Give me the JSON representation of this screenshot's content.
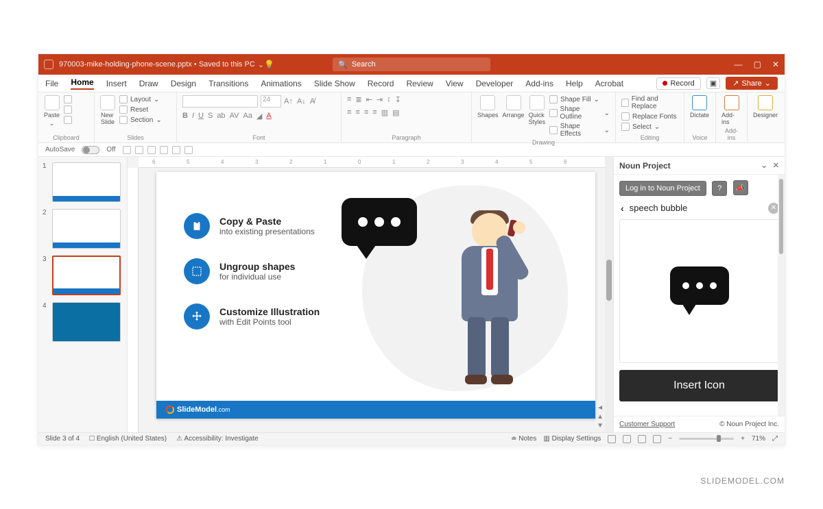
{
  "titlebar": {
    "filename": "970003-mike-holding-phone-scene.pptx",
    "save_state": "Saved to this PC",
    "search_placeholder": "Search"
  },
  "tabs": [
    "File",
    "Home",
    "Insert",
    "Draw",
    "Design",
    "Transitions",
    "Animations",
    "Slide Show",
    "Record",
    "Review",
    "View",
    "Developer",
    "Add-ins",
    "Help",
    "Acrobat"
  ],
  "active_tab": "Home",
  "right_tools": {
    "record": "Record",
    "share": "Share"
  },
  "ribbon": {
    "clipboard": {
      "paste": "Paste",
      "label": "Clipboard"
    },
    "slides": {
      "new_slide": "New\nSlide",
      "layout": "Layout",
      "reset": "Reset",
      "section": "Section",
      "label": "Slides"
    },
    "font": {
      "size": "24",
      "label": "Font"
    },
    "paragraph": {
      "label": "Paragraph"
    },
    "drawing": {
      "shapes": "Shapes",
      "arrange": "Arrange",
      "quick": "Quick\nStyles",
      "fill": "Shape Fill",
      "outline": "Shape Outline",
      "effects": "Shape Effects",
      "label": "Drawing"
    },
    "editing": {
      "find": "Find and Replace",
      "replace": "Replace Fonts",
      "select": "Select",
      "label": "Editing"
    },
    "voice": {
      "dictate": "Dictate",
      "label": "Voice"
    },
    "addins": {
      "addins": "Add-ins",
      "label": "Add-ins"
    },
    "designer": {
      "designer": "Designer"
    }
  },
  "qat": {
    "autosave": "AutoSave",
    "state": "Off"
  },
  "thumbs": {
    "count": 4,
    "selected": 3
  },
  "slide": {
    "features": [
      {
        "title": "Copy & Paste",
        "sub": "into existing presentations",
        "icon": "clipboard"
      },
      {
        "title": "Ungroup shapes",
        "sub": "for individual use",
        "icon": "ungroup"
      },
      {
        "title": "Customize Illustration",
        "sub": "with Edit Points tool",
        "icon": "move"
      }
    ],
    "brand": "SlideModel",
    "brand_suffix": ".com"
  },
  "side_panel": {
    "title": "Noun Project",
    "login": "Log in to Noun Project",
    "search": "speech bubble",
    "insert": "Insert Icon",
    "support": "Customer Support",
    "copyright": "© Noun Project Inc."
  },
  "status": {
    "slide": "Slide 3 of 4",
    "lang": "English (United States)",
    "access": "Accessibility: Investigate",
    "notes": "Notes",
    "display": "Display Settings",
    "zoom": "71%"
  },
  "ruler_ticks": [
    "6",
    "5",
    "4",
    "3",
    "2",
    "1",
    "0",
    "1",
    "2",
    "3",
    "4",
    "5",
    "6"
  ],
  "watermark": "SLIDEMODEL.COM"
}
